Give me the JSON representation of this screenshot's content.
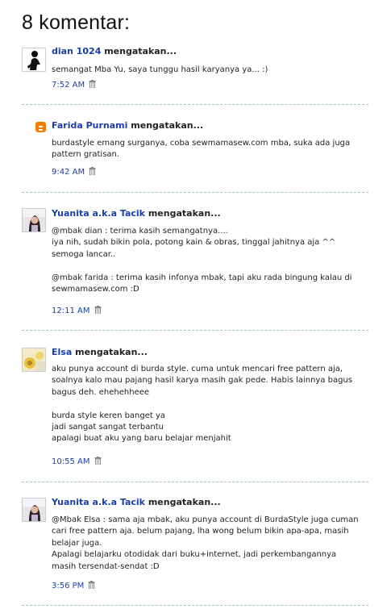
{
  "page_title": "8 komentar:",
  "says_label": "mengatakan...",
  "comments": [
    {
      "author": "dian 1024",
      "avatar": "silhouette-avatar",
      "text": "semangat Mba Yu, saya tunggu hasil karyanya ya... :)",
      "time": "7:52 AM"
    },
    {
      "author": "Farida Purnami",
      "avatar": "blogger-icon",
      "text": "burdastyle emang surganya, coba sewmamasew.com mba, suka ada juga\npattern gratisan.",
      "time": "9:42 AM"
    },
    {
      "author": "Yuanita a.k.a Tacik",
      "avatar": "photo-avatar",
      "text": "@mbak dian : terima kasih semangatnya....\niya nih, sudah bikin pola, potong kain & obras, tinggal jahitnya aja ^^\nsemoga lancar..\n\n@mbak farida : terima kasih infonya mbak, tapi aku rada bingung kalau di\nsewmamasew.com :D",
      "time": "12:11 AM"
    },
    {
      "author": "Elsa",
      "avatar": "photo-avatar",
      "text": "aku punya account di burda style. cuma untuk mencari free pattern aja,\nsoalnya kalo mau pajang hasil karya masih gak pede. Habis lainnya bagus\nbagus deh. ehehehheee\n\nburda style keren banget ya\njadi sangat sangat terbantu\napalagi buat aku yang baru belajar menjahit",
      "time": "10:55 AM"
    },
    {
      "author": "Yuanita a.k.a Tacik",
      "avatar": "photo-avatar",
      "text": "@Mbak Elsa : sama aja mbak, aku punya account di BurdaStyle juga cuman\ncari free pattern aja. belum pajang, lha wong belum bikin apa-apa, masih\nbelajar juga.\nApalagi belajarku otodidak dari buku+internet, jadi perkembangannya\nmasih tersendat-sendat :D",
      "time": "3:56 PM"
    }
  ],
  "colors": {
    "link": "#1b3ea8",
    "separator": "#9fc3c8",
    "blogger": "#f57d00"
  }
}
